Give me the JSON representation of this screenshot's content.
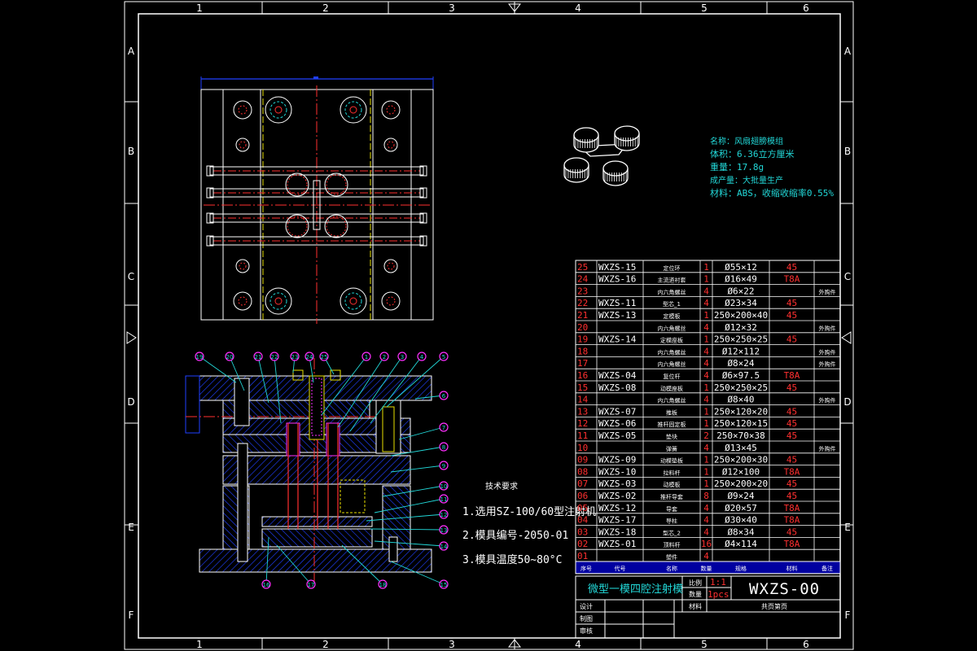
{
  "frame": {
    "zone_cols": [
      "1",
      "2",
      "3",
      "4",
      "5",
      "6"
    ],
    "zone_rows": [
      "A",
      "B",
      "C",
      "D",
      "E",
      "F"
    ]
  },
  "part_info": {
    "name": "名称：风扇翅膀模组",
    "volume": "体积：6.36立方厘米",
    "weight": "重量：17.8g",
    "production": "成产量：大批量生产",
    "material": "材料：ABS，收缩收缩率0.55%"
  },
  "tech_requirements": {
    "title": "技术要求",
    "items": [
      "1.选用SZ-100/60型注射机",
      "2.模具编号-2050-01",
      "3.模具温度50~80°C"
    ]
  },
  "bom": {
    "rows": [
      {
        "no": "25",
        "code": "WXZS-15",
        "name": "定位环",
        "qty": "1",
        "spec": "Ø55×12",
        "mat": "45",
        "note": ""
      },
      {
        "no": "24",
        "code": "WXZS-16",
        "name": "主流道衬套",
        "qty": "1",
        "spec": "Ø16×49",
        "mat": "T8A",
        "note": ""
      },
      {
        "no": "23",
        "code": "",
        "name": "内六角螺丝",
        "qty": "4",
        "spec": "Ø6×22",
        "mat": "",
        "note": "外购件"
      },
      {
        "no": "22",
        "code": "WXZS-11",
        "name": "型芯_1",
        "qty": "4",
        "spec": "Ø23×34",
        "mat": "45",
        "note": ""
      },
      {
        "no": "21",
        "code": "WXZS-13",
        "name": "定模板",
        "qty": "1",
        "spec": "250×200×40",
        "mat": "45",
        "note": ""
      },
      {
        "no": "20",
        "code": "",
        "name": "内六角螺丝",
        "qty": "4",
        "spec": "Ø12×32",
        "mat": "",
        "note": "外购件"
      },
      {
        "no": "19",
        "code": "WXZS-14",
        "name": "定模座板",
        "qty": "1",
        "spec": "250×250×25",
        "mat": "45",
        "note": ""
      },
      {
        "no": "18",
        "code": "",
        "name": "内六角螺丝",
        "qty": "4",
        "spec": "Ø12×112",
        "mat": "",
        "note": "外购件"
      },
      {
        "no": "17",
        "code": "",
        "name": "内六角螺丝",
        "qty": "4",
        "spec": "Ø8×24",
        "mat": "",
        "note": "外购件"
      },
      {
        "no": "16",
        "code": "WXZS-04",
        "name": "复位杆",
        "qty": "4",
        "spec": "Ø6×97.5",
        "mat": "T8A",
        "note": ""
      },
      {
        "no": "15",
        "code": "WXZS-08",
        "name": "动模座板",
        "qty": "1",
        "spec": "250×250×25",
        "mat": "45",
        "note": ""
      },
      {
        "no": "14",
        "code": "",
        "name": "内六角螺丝",
        "qty": "4",
        "spec": "Ø8×40",
        "mat": "",
        "note": "外购件"
      },
      {
        "no": "13",
        "code": "WXZS-07",
        "name": "推板",
        "qty": "1",
        "spec": "250×120×20",
        "mat": "45",
        "note": ""
      },
      {
        "no": "12",
        "code": "WXZS-06",
        "name": "推杆固定板",
        "qty": "1",
        "spec": "250×120×15",
        "mat": "45",
        "note": ""
      },
      {
        "no": "11",
        "code": "WXZS-05",
        "name": "垫块",
        "qty": "2",
        "spec": "250×70×38",
        "mat": "45",
        "note": ""
      },
      {
        "no": "10",
        "code": "",
        "name": "弹簧",
        "qty": "4",
        "spec": "Ø13×45",
        "mat": "",
        "note": "外购件"
      },
      {
        "no": "09",
        "code": "WXZS-09",
        "name": "动模垫板",
        "qty": "1",
        "spec": "250×200×30",
        "mat": "45",
        "note": ""
      },
      {
        "no": "08",
        "code": "WXZS-10",
        "name": "拉料杆",
        "qty": "1",
        "spec": "Ø12×100",
        "mat": "T8A",
        "note": ""
      },
      {
        "no": "07",
        "code": "WXZS-03",
        "name": "动模板",
        "qty": "1",
        "spec": "250×200×20",
        "mat": "45",
        "note": ""
      },
      {
        "no": "06",
        "code": "WXZS-02",
        "name": "推杆导套",
        "qty": "8",
        "spec": "Ø9×24",
        "mat": "45",
        "note": ""
      },
      {
        "no": "05",
        "code": "WXZS-12",
        "name": "导套",
        "qty": "4",
        "spec": "Ø20×57",
        "mat": "T8A",
        "note": ""
      },
      {
        "no": "04",
        "code": "WXZS-17",
        "name": "导柱",
        "qty": "4",
        "spec": "Ø30×40",
        "mat": "T8A",
        "note": ""
      },
      {
        "no": "03",
        "code": "WXZS-18",
        "name": "型芯_2",
        "qty": "4",
        "spec": "Ø8×34",
        "mat": "45",
        "note": ""
      },
      {
        "no": "02",
        "code": "WXZS-01",
        "name": "顶料杆",
        "qty": "16",
        "spec": "Ø4×114",
        "mat": "T8A",
        "note": ""
      },
      {
        "no": "01",
        "code": "",
        "name": "塑件",
        "qty": "4",
        "spec": "",
        "mat": "",
        "note": ""
      }
    ],
    "header": {
      "no": "序号",
      "code": "代号",
      "name": "名称",
      "qty": "数量",
      "spec": "规格",
      "mat": "材料",
      "note": "备注"
    }
  },
  "title_block": {
    "drawing_title": "微型一模四腔注射模",
    "scale_label": "比例",
    "scale_value": "1:1",
    "qty_label": "数量",
    "qty_value": "1pcs",
    "weight_label": "材料",
    "drawing_number": "WXZS-00",
    "design": "设计",
    "drafting": "制图",
    "review": "审核",
    "sheet": "共页第页"
  },
  "callouts": [
    "19",
    "20",
    "21",
    "22",
    "23",
    "24",
    "25",
    "1",
    "2",
    "3",
    "4",
    "5",
    "6",
    "7",
    "8",
    "9",
    "10",
    "11",
    "12",
    "13",
    "14",
    "15",
    "16",
    "17",
    "18"
  ],
  "colors": {
    "background": "#000000",
    "lines": "#ffffff",
    "cyan": "#22d8d8",
    "red": "#ff3030",
    "yellow": "#e8e000",
    "magenta": "#ff30ff",
    "blue": "#2040ff"
  }
}
